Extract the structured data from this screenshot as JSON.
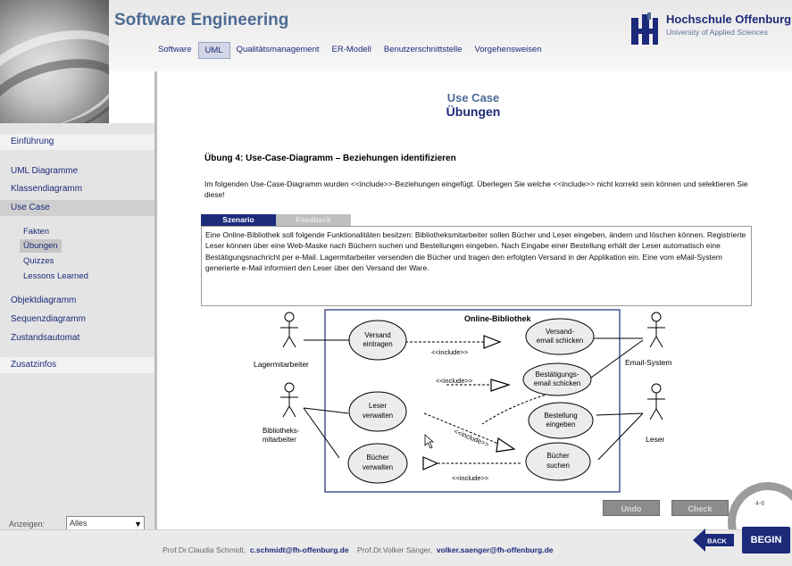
{
  "header": {
    "title": "Software Engineering",
    "nav": [
      "Software",
      "UML",
      "Qualitätsmanagement",
      "ER-Modell",
      "Benutzerschnittstelle",
      "Vorgehensweisen"
    ],
    "active_nav": "UML",
    "university": {
      "name": "Hochschule Offenburg",
      "subtitle": "University of Applied Sciences"
    }
  },
  "sidebar": {
    "items": [
      "Einführung",
      "UML Diagramme",
      "Klassendiagramm",
      "Use Case"
    ],
    "sub_items": [
      "Fakten",
      "Übungen",
      "Quizzes",
      "Lessons Learned"
    ],
    "active_sub": "Übungen",
    "items_after": [
      "Objektdiagramm",
      "Sequenzdiagramm",
      "Zustandsautomat",
      "Zusatzinfos"
    ],
    "show_label": "Anzeigen:",
    "show_value": "Alles"
  },
  "main": {
    "kicker": "Use Case",
    "heading": "Übungen",
    "exercise_title": "Übung 4: Use-Case-Diagramm – Beziehungen identifizieren",
    "instructions": "Im folgenden Use-Case-Diagramm wurden <<include>>-Beziehungen eingefügt. Überlegen Sie welche <<include>> nicht korrekt sein können und selektieren Sie diese!",
    "tabs": [
      "Szenario",
      "Feedback"
    ],
    "scenario_text": "Eine Online-Bibliothek soll folgende Funktionalitäten besitzen: Bibliotheksmitarbeiter sollen Bücher und Leser eingeben, ändern und löschen können. Registrierte Leser können über eine Web-Maske nach Büchern suchen und Bestellungen eingeben. Nach Eingabe einer Bestellung erhält der Leser automatisch eine Bestätigungsnachricht per e-Mail. Lagermitarbeiter versenden die Bücher und tragen den erfolgten Versand in der Applikation ein. Eine vom eMail-System generierte e-Mail informiert den Leser über den Versand der Ware."
  },
  "diagram": {
    "system": "Online-Bibliothek",
    "actors": [
      "Lagermitarbeiter",
      "Bibliotheks-",
      "mitarbeiter",
      "Email-System",
      "Leser"
    ],
    "use_cases": {
      "versand": [
        "Versand",
        "eintragen"
      ],
      "versandmail": [
        "Versand-",
        "email schicken"
      ],
      "bestaetigung": [
        "Bestätigungs-",
        "email schicken"
      ],
      "leser": [
        "Leser",
        "verwalten"
      ],
      "bestellung": [
        "Bestellung",
        "eingeben"
      ],
      "buecher_verwalten": [
        "Bücher",
        "verwalten"
      ],
      "buecher_suchen": [
        "Bücher",
        "suchen"
      ]
    },
    "include_label": "<<include>>"
  },
  "controls": {
    "undo": "Undo",
    "check": "Check",
    "page": "4-6",
    "back": "BACK",
    "begin": "BEGIN"
  },
  "footer": {
    "author1": "Prof.Dr.Claudia Schmidt,",
    "email1": "c.schmidt@fh-offenburg.de",
    "author2": "Prof.Dr.Volker Sänger,",
    "email2": "volker.saenger@fh-offenburg.de"
  }
}
